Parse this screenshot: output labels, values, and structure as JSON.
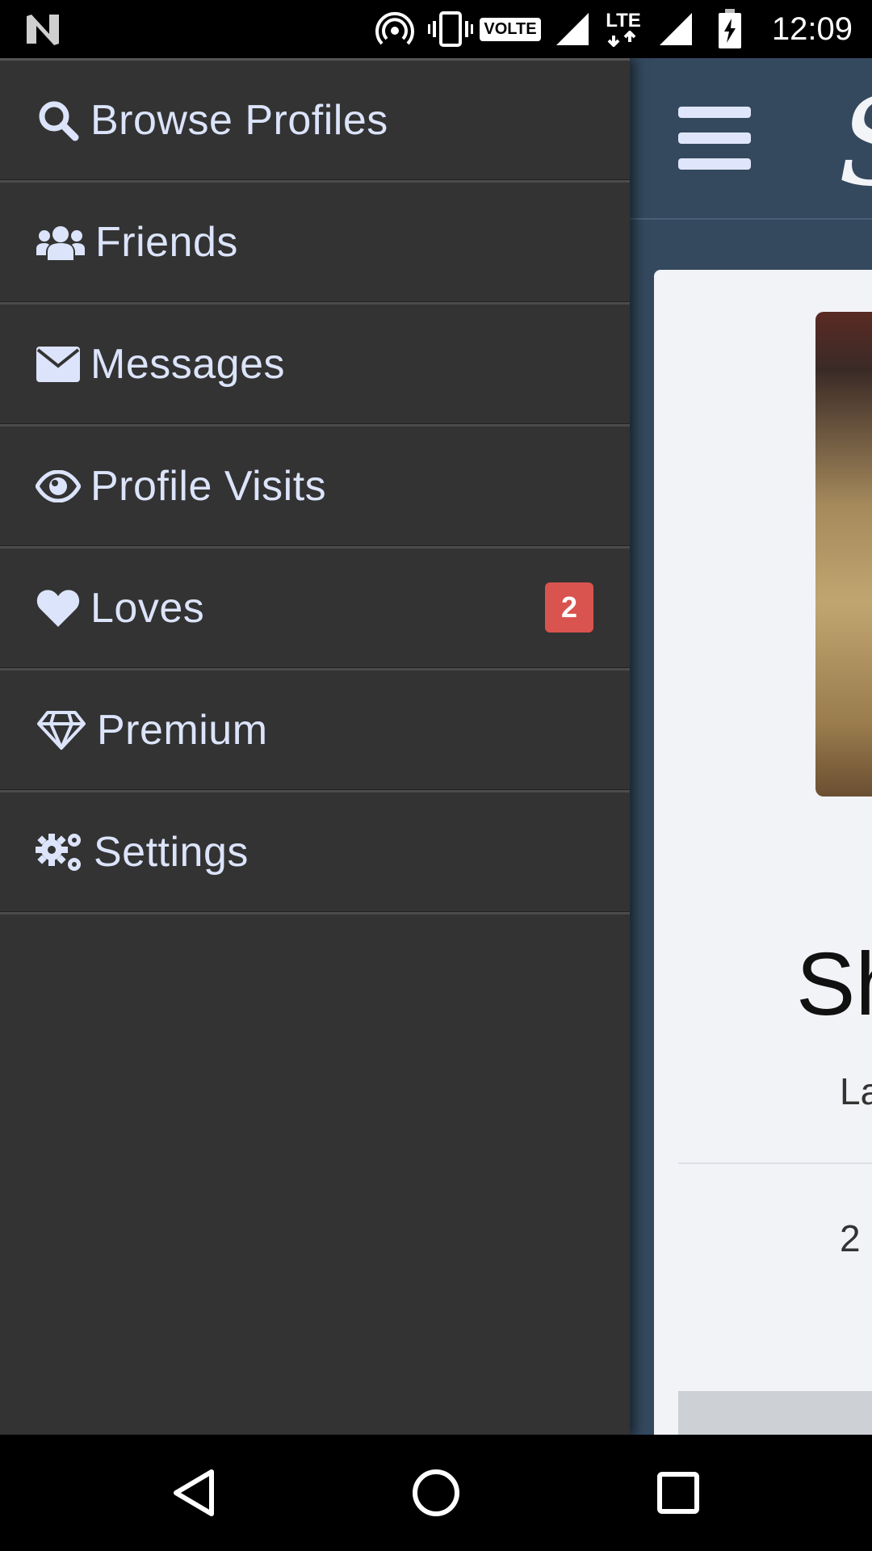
{
  "status_bar": {
    "time": "12:09",
    "network_label": "LTE",
    "volte_label": "VOLTE",
    "icons": [
      "notification-n-icon",
      "hotspot-icon",
      "vibrate-icon",
      "volte-icon",
      "signal-icon",
      "lte-icon",
      "signal-icon",
      "battery-charging-icon"
    ]
  },
  "drawer": {
    "items": [
      {
        "label": "Browse Profiles",
        "icon": "search-icon"
      },
      {
        "label": "Friends",
        "icon": "users-icon"
      },
      {
        "label": "Messages",
        "icon": "envelope-icon"
      },
      {
        "label": "Profile Visits",
        "icon": "eye-icon"
      },
      {
        "label": "Loves",
        "icon": "heart-icon",
        "badge": "2"
      },
      {
        "label": "Premium",
        "icon": "diamond-icon"
      },
      {
        "label": "Settings",
        "icon": "gears-icon"
      }
    ]
  },
  "app": {
    "logo_glyph": "S",
    "profile": {
      "name_partial": "Sh",
      "subtitle_partial": "La",
      "stat_partial": "2"
    }
  },
  "colors": {
    "drawer_bg": "#333333",
    "drawer_text": "#dce4fb",
    "app_header": "#34495e",
    "badge": "#d9534f"
  },
  "nav_bar": {
    "buttons": [
      "back-icon",
      "home-icon",
      "recents-icon"
    ]
  }
}
